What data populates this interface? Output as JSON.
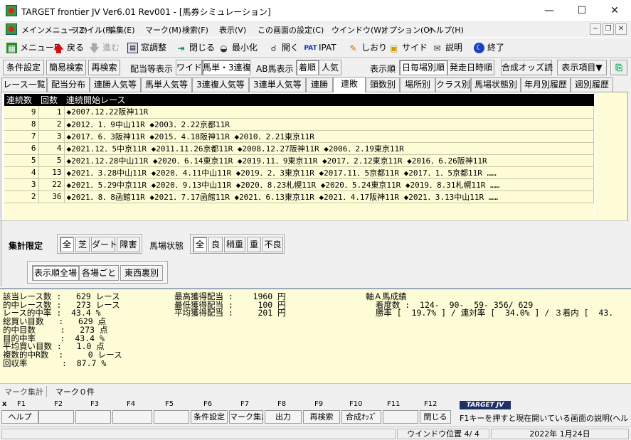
{
  "window": {
    "title": "TARGET frontier JV  Ver6.01  Rev001 - [馬券シミュレーション]"
  },
  "menu": [
    {
      "label": "メインメニュー(Z)"
    },
    {
      "label": "ファイル(F)"
    },
    {
      "label": "編集(E)"
    },
    {
      "label": "マーク(M)"
    },
    {
      "label": "検索(F)"
    },
    {
      "label": "表示(V)"
    },
    {
      "label": "この画面の設定(C)"
    },
    {
      "label": "ウインドウ(W)"
    },
    {
      "label": "オプション(O)"
    },
    {
      "label": "ヘルプ(H)"
    }
  ],
  "toolbar": [
    {
      "label": "メニューP",
      "icon": "menu-icon"
    },
    {
      "label": "戻る",
      "icon": "up-arrow-icon"
    },
    {
      "label": "進む",
      "icon": "down-arrow-icon",
      "disabled": true
    },
    {
      "label": "窓調整",
      "icon": "window-adjust-icon"
    },
    {
      "label": "閉じる",
      "icon": "close-icon"
    },
    {
      "label": "最小化",
      "icon": "minimize-icon"
    },
    {
      "label": "開く",
      "icon": "open-icon"
    },
    {
      "label": "IPAT",
      "icon": "ipat-icon"
    },
    {
      "label": "しおり",
      "icon": "bookmark-icon"
    },
    {
      "label": "サイド",
      "icon": "side-icon"
    },
    {
      "label": "説明",
      "icon": "help-icon"
    },
    {
      "label": "終了",
      "icon": "exit-icon"
    }
  ],
  "row2": {
    "cond": "条件設定",
    "simple": "簡易検索",
    "research": "再検索",
    "payout_label": "配当等表示",
    "wide": "ワイド",
    "umaban": "馬単・3連複",
    "ab_label": "AB馬表示",
    "chakujun": "着順",
    "ninki": "人気",
    "order_label": "表示順",
    "by_day": "日毎場別順",
    "by_time": "発走日時順",
    "goseiodds": "合成オッズ読",
    "items": "表示項目▼"
  },
  "tabs": [
    "レース一覧",
    "配当分布",
    "連勝人気等",
    "馬単人気等",
    "3連複人気等",
    "3連単人気等",
    "連勝",
    "連敗",
    "頭数別",
    "場所別",
    "クラス別",
    "馬場状態別",
    "年月別履歴",
    "週別履歴"
  ],
  "table": {
    "headers": [
      "連続数",
      "回数",
      "連続開始レース"
    ],
    "rows": [
      {
        "streak": "9",
        "count": "1",
        "races": "◆2007.12.22阪神11R"
      },
      {
        "streak": "8",
        "count": "2",
        "races": "◆2012．1．9中山11R ◆2003．2.22京都11R"
      },
      {
        "streak": "7",
        "count": "3",
        "races": "◆2017．6．3阪神11R ◆2015．4.18阪神11R ◆2010．2.21東京11R"
      },
      {
        "streak": "6",
        "count": "4",
        "races": "◆2021.12．5中京11R ◆2011.11.26京都11R ◆2008.12.27阪神11R ◆2006．2.19東京11R"
      },
      {
        "streak": "5",
        "count": "5",
        "races": "◆2021.12.28中山11R ◆2020．6.14東京11R ◆2019.11．9東京11R ◆2017．2.12東京11R ◆2016．6.26阪神11R"
      },
      {
        "streak": "4",
        "count": "13",
        "races": "◆2021．3.28中山11R ◆2020．4.11中山11R ◆2019．2．3東京11R ◆2017.11．5京都11R ◆2017．1．5京都11R ……"
      },
      {
        "streak": "3",
        "count": "22",
        "races": "◆2021．5.29中京11R ◆2020．9.13中山11R ◆2020．8.23札幌11R ◆2020．5.24東京11R ◆2019．8.31札幌11R ……"
      },
      {
        "streak": "2",
        "count": "36",
        "races": "◆2021．8．8函館11R ◆2021．7.17函館11R ◆2021．6.13東京11R ◆2021．4.17阪神11R ◆2021．3.13中山11R ……"
      }
    ]
  },
  "filters": {
    "agg_label": "集計限定",
    "course": [
      "全",
      "芝",
      "ダート",
      "障害"
    ],
    "baba_label": "馬場状態",
    "baba": [
      "全",
      "良",
      "稍重",
      "重",
      "不良"
    ],
    "view": [
      "表示順全場",
      "各場ごと",
      "東西裏別"
    ]
  },
  "summary": {
    "col1": [
      "該当レース数 :   629 レース",
      "的中レース数 :   273 レース",
      "レース的中率 :  43.4 %",
      "総買い目数   :   629 点",
      "的中目数     :   273 点",
      "目的中率     :  43.4 %",
      "平均買い目数 :   1.0 点",
      "複数的中R数  :     0 レース",
      "回収率       :  87.7 %"
    ],
    "col2": [
      "最高獲得配当 :    1960 円",
      "最低獲得配当 :     100 円",
      "平均獲得配当 :     201 円"
    ],
    "col3": [
      "軸Ａ馬成績",
      "  着度数 :  124-  90-  59- 356/ 629",
      "  勝率 [  19.7% ] / 連対率 [  34.0% ] / ３着内 [  43."
    ]
  },
  "markbar": {
    "label": "マーク集計",
    "count": "マーク０件"
  },
  "fkeys": {
    "keys": [
      "F1",
      "F2",
      "F3",
      "F4",
      "F5",
      "F6",
      "F7",
      "F8",
      "F9",
      "F10",
      "F11",
      "F12"
    ],
    "buttons": [
      "ヘルプ",
      "",
      "",
      "",
      "",
      "条件設定",
      "マーク集計",
      "出力",
      "再検索",
      "合成ｵｯｽﾞ",
      "",
      "閉じる"
    ],
    "logo": "TARGET JV",
    "hint": "F1キーを押すと現在開いている画面の説明(ヘル"
  },
  "status": {
    "window_pos": "ウインドウ位置 4/ 4",
    "date": "2022年 1月24日"
  }
}
